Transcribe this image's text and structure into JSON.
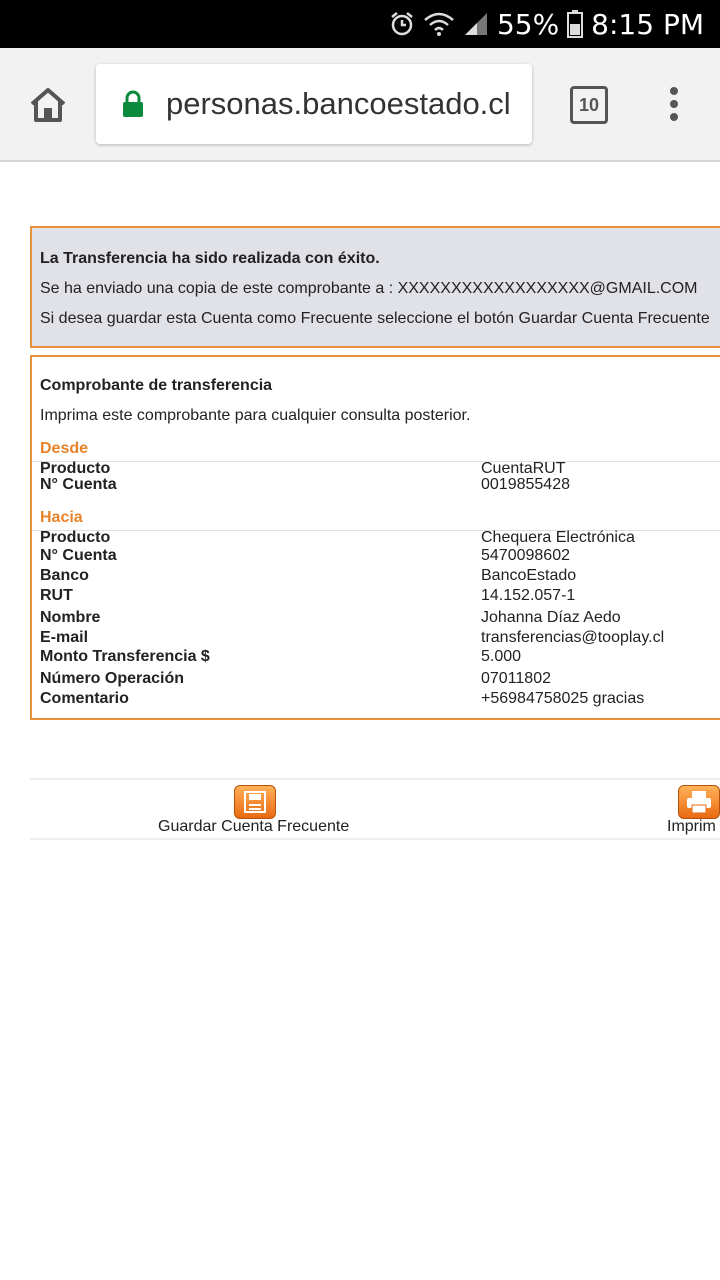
{
  "status_bar": {
    "battery": "55%",
    "time": "8:15 PM"
  },
  "browser": {
    "url": "personas.bancoestado.cl",
    "tab_count": "10"
  },
  "notice": {
    "success": "La Transferencia ha sido realizada con éxito.",
    "copy_sent": "Se ha enviado una copia de este comprobante a : XXXXXXXXXXXXXXXXXX@GMAIL.COM",
    "save_hint": "Si desea guardar esta Cuenta como Frecuente seleccione el botón Guardar Cuenta Frecuente"
  },
  "receipt": {
    "title": "Comprobante de transferencia",
    "subtitle": "Imprima este comprobante para cualquier consulta posterior.",
    "from_heading": "Desde",
    "from": [
      {
        "label": "Producto",
        "value": "CuentaRUT"
      },
      {
        "label": "N° Cuenta",
        "value": "0019855428"
      }
    ],
    "to_heading": "Hacia",
    "to": [
      {
        "label": "Producto",
        "value": "Chequera Electrónica"
      },
      {
        "label": "N° Cuenta",
        "value": "5470098602"
      },
      {
        "label": "Banco",
        "value": "BancoEstado"
      },
      {
        "label": "RUT",
        "value": "14.152.057-1"
      },
      {
        "label": "Nombre",
        "value": "Johanna Díaz Aedo"
      },
      {
        "label": "E-mail",
        "value": "transferencias@tooplay.cl"
      },
      {
        "label": "Monto Transferencia $",
        "value": "5.000"
      },
      {
        "label": "Número Operación",
        "value": "07011802"
      },
      {
        "label": "Comentario",
        "value": "+56984758025 gracias"
      }
    ]
  },
  "actions": {
    "save_label": "Guardar Cuenta Frecuente",
    "print_label": "Imprim",
    "save_icon": "save-icon",
    "print_icon": "printer-icon"
  }
}
